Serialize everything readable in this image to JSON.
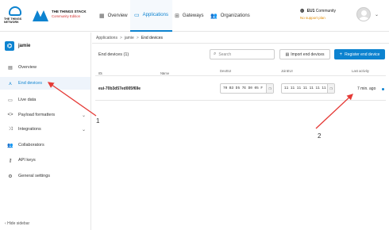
{
  "topbar": {
    "logo1_text": "THE THINGS NETWORK",
    "logo2_line1": "THE THINGS STACK",
    "logo2_line2": "Community Edition",
    "tabs": [
      {
        "label": "Overview",
        "icon": "grid-icon"
      },
      {
        "label": "Applications",
        "icon": "folder-icon"
      },
      {
        "label": "Gateways",
        "icon": "gateway-icon"
      },
      {
        "label": "Organizations",
        "icon": "people-icon"
      }
    ],
    "cluster_name": "EU1",
    "cluster_label": "Community",
    "support_text": "No support plan",
    "avatar_icon": "user-avatar-icon"
  },
  "sidebar": {
    "app_name": "jamie",
    "items": [
      {
        "label": "Overview",
        "icon": "overview-icon"
      },
      {
        "label": "End devices",
        "icon": "device-icon"
      },
      {
        "label": "Live data",
        "icon": "live-data-icon"
      },
      {
        "label": "Payload formatters",
        "icon": "code-icon"
      },
      {
        "label": "Integrations",
        "icon": "integrations-icon"
      },
      {
        "label": "Collaborators",
        "icon": "collaborators-icon"
      },
      {
        "label": "API keys",
        "icon": "key-icon"
      },
      {
        "label": "General settings",
        "icon": "settings-icon"
      }
    ],
    "hide_label": "Hide sidebar"
  },
  "breadcrumb": [
    "Applications",
    "jamie",
    "End devices"
  ],
  "main": {
    "title": "End devices (1)",
    "search_placeholder": "Search",
    "import_label": "Import end devices",
    "register_label": "Register end device",
    "columns": [
      "ID",
      "Name",
      "DevEUI",
      "JoinEUI",
      "Last activity"
    ],
    "rows": [
      {
        "id": "eui-70b3d57ed005f69e",
        "name": "",
        "dev_eui": "70 B3 D5 7E D0 05 F",
        "join_eui": "11 11 11 11 11 11 11 11",
        "last_activity": "7 min. ago"
      }
    ]
  },
  "annotations": {
    "label1": "1",
    "label2": "2",
    "color": "#e53935"
  },
  "colors": {
    "accent": "#0d83d0",
    "warning": "#e08a00"
  }
}
